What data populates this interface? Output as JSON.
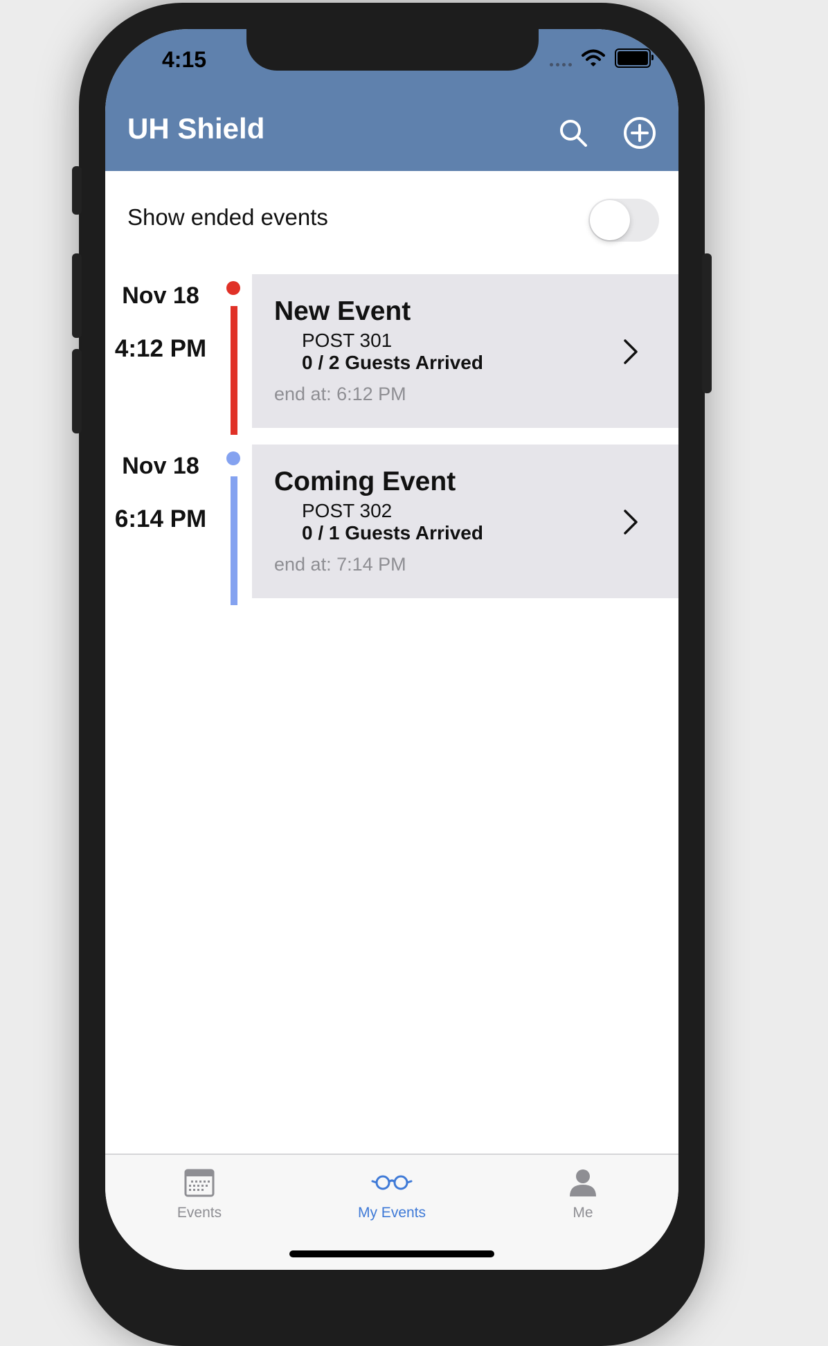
{
  "status_bar": {
    "time": "4:15"
  },
  "header": {
    "title": "UH Shield",
    "search_icon": "search-icon",
    "add_icon": "plus-circle-icon"
  },
  "filter": {
    "label": "Show ended events",
    "toggle_on": false
  },
  "events": [
    {
      "date": "Nov 18",
      "time": "4:12 PM",
      "name": "New Event",
      "post": "POST 301",
      "guests": "0 / 2 Guests Arrived",
      "end": "end at: 6:12 PM",
      "color": "#e03127"
    },
    {
      "date": "Nov 18",
      "time": "6:14 PM",
      "name": "Coming Event",
      "post": "POST 302",
      "guests": "0 / 1 Guests Arrived",
      "end": "end at: 7:14 PM",
      "color": "#84a2f0"
    }
  ],
  "tabs": [
    {
      "label": "Events",
      "icon": "calendar-icon",
      "active": false
    },
    {
      "label": "My Events",
      "icon": "glasses-icon",
      "active": true
    },
    {
      "label": "Me",
      "icon": "person-icon",
      "active": false
    }
  ],
  "colors": {
    "header_bg": "#5f81ad",
    "card_bg": "#e6e5ea",
    "tab_active": "#3f7ad7",
    "tab_inactive": "#8e8e93"
  }
}
